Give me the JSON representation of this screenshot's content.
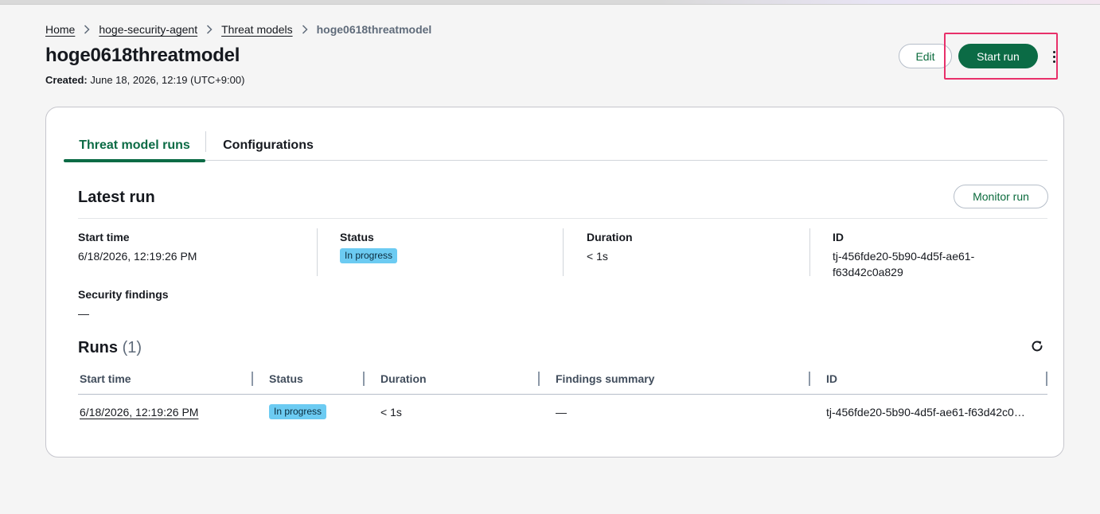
{
  "breadcrumb": {
    "items": [
      "Home",
      "hoge-security-agent",
      "Threat models"
    ],
    "current": "hoge0618threatmodel"
  },
  "header": {
    "title": "hoge0618threatmodel",
    "created_label": "Created:",
    "created_value": "June 18, 2026, 12:19 (UTC+9:00)",
    "edit_label": "Edit",
    "start_run_label": "Start run",
    "more_icon": "more-vertical-icon"
  },
  "tabs": {
    "runs": "Threat model runs",
    "config": "Configurations"
  },
  "latest": {
    "title": "Latest run",
    "monitor_label": "Monitor run",
    "start_time_label": "Start time",
    "start_time_value": "6/18/2026, 12:19:26 PM",
    "status_label": "Status",
    "status_value": "In progress",
    "duration_label": "Duration",
    "duration_value": "< 1s",
    "id_label": "ID",
    "id_line1": "tj-456fde20-5b90-4d5f-ae61-",
    "id_line2": "f63d42c0a829",
    "findings_label": "Security findings",
    "findings_value": "—"
  },
  "runs": {
    "title": "Runs",
    "count": "(1)",
    "refresh_icon": "refresh-icon",
    "columns": [
      "Start time",
      "Status",
      "Duration",
      "Findings summary",
      "ID"
    ],
    "rows": [
      {
        "start_time": "6/18/2026, 12:19:26 PM",
        "status": "In progress",
        "duration": "< 1s",
        "findings": "—",
        "id": "tj-456fde20-5b90-4d5f-ae61-f63d42c0…"
      }
    ]
  },
  "colors": {
    "primary": "#0b6b45",
    "badge": "#6ccbf2",
    "highlight": "#e8306a"
  }
}
